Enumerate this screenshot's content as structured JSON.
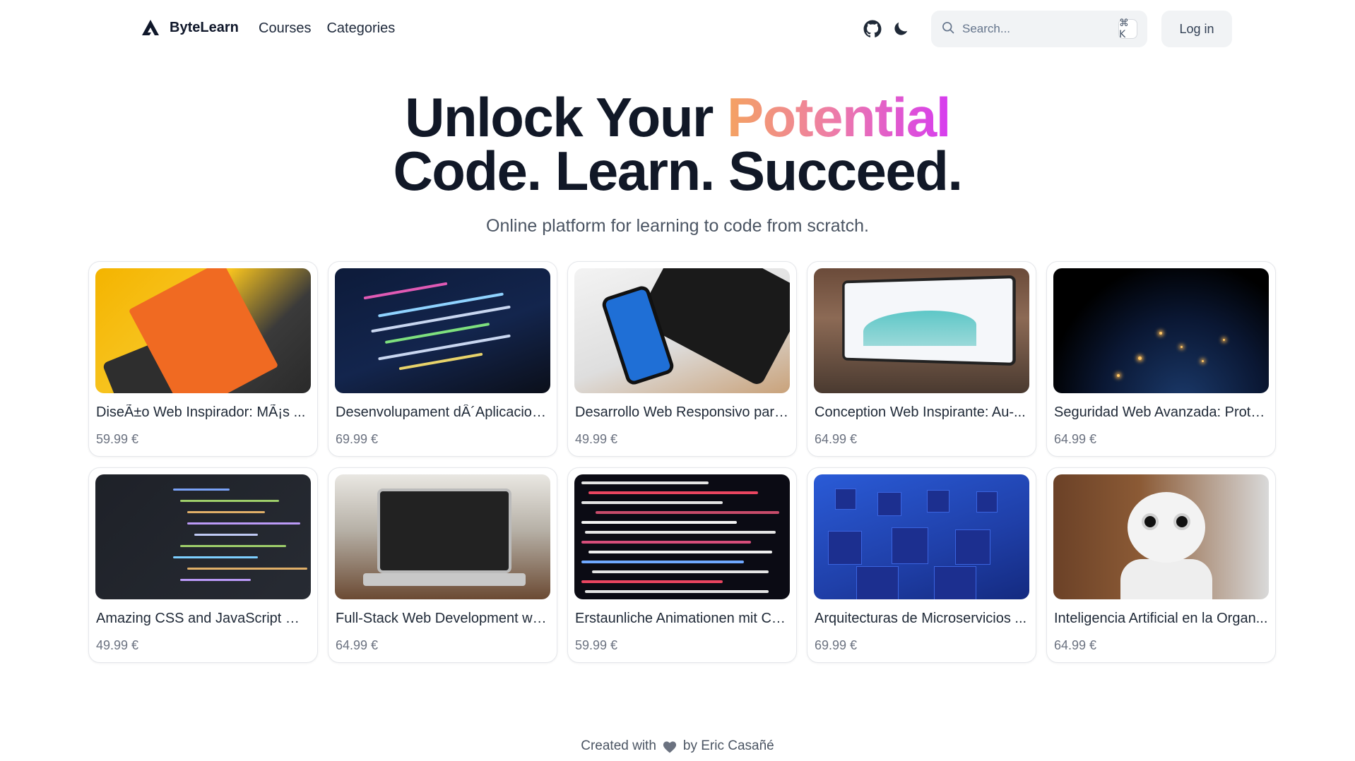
{
  "brand": {
    "name": "ByteLearn",
    "logo_icon": "triangle-logo-icon"
  },
  "nav": {
    "items": [
      "Courses",
      "Categories"
    ]
  },
  "header": {
    "github_icon": "github-icon",
    "theme_icon": "moon-icon",
    "search": {
      "placeholder": "Search...",
      "shortcut": "⌘ K",
      "icon": "search-icon"
    },
    "login_label": "Log in"
  },
  "hero": {
    "title_part1": "Unlock Your ",
    "title_highlight": "Potential",
    "title_line2": "Code. Learn. Succeed.",
    "subtitle": "Online platform for learning to code from scratch.",
    "gradient_colors": [
      "#f4a261",
      "#ee7fa4",
      "#d63cf0"
    ]
  },
  "courses": [
    {
      "title": "DiseÃ±o Web Inspirador: MÃ¡s ...",
      "price": "59.99 €"
    },
    {
      "title": "Desenvolupament dÂ´Aplicacion...",
      "price": "69.99 €"
    },
    {
      "title": "Desarrollo Web Responsivo para...",
      "price": "49.99 €"
    },
    {
      "title": "Conception Web Inspirante: Au-...",
      "price": "64.99 €"
    },
    {
      "title": "Seguridad Web Avanzada: Prote...",
      "price": "64.99 €"
    },
    {
      "title": "Amazing CSS and JavaScript We...",
      "price": "49.99 €"
    },
    {
      "title": "Full-Stack Web Development wit...",
      "price": "64.99 €"
    },
    {
      "title": "Erstaunliche Animationen mit CS...",
      "price": "59.99 €"
    },
    {
      "title": "Arquitecturas de Microservicios ...",
      "price": "69.99 €"
    },
    {
      "title": "Inteligencia Artificial en la Organ...",
      "price": "64.99 €"
    }
  ],
  "footer": {
    "prefix": "Created with",
    "icon": "heart-icon",
    "suffix": "by Eric Casañé"
  }
}
